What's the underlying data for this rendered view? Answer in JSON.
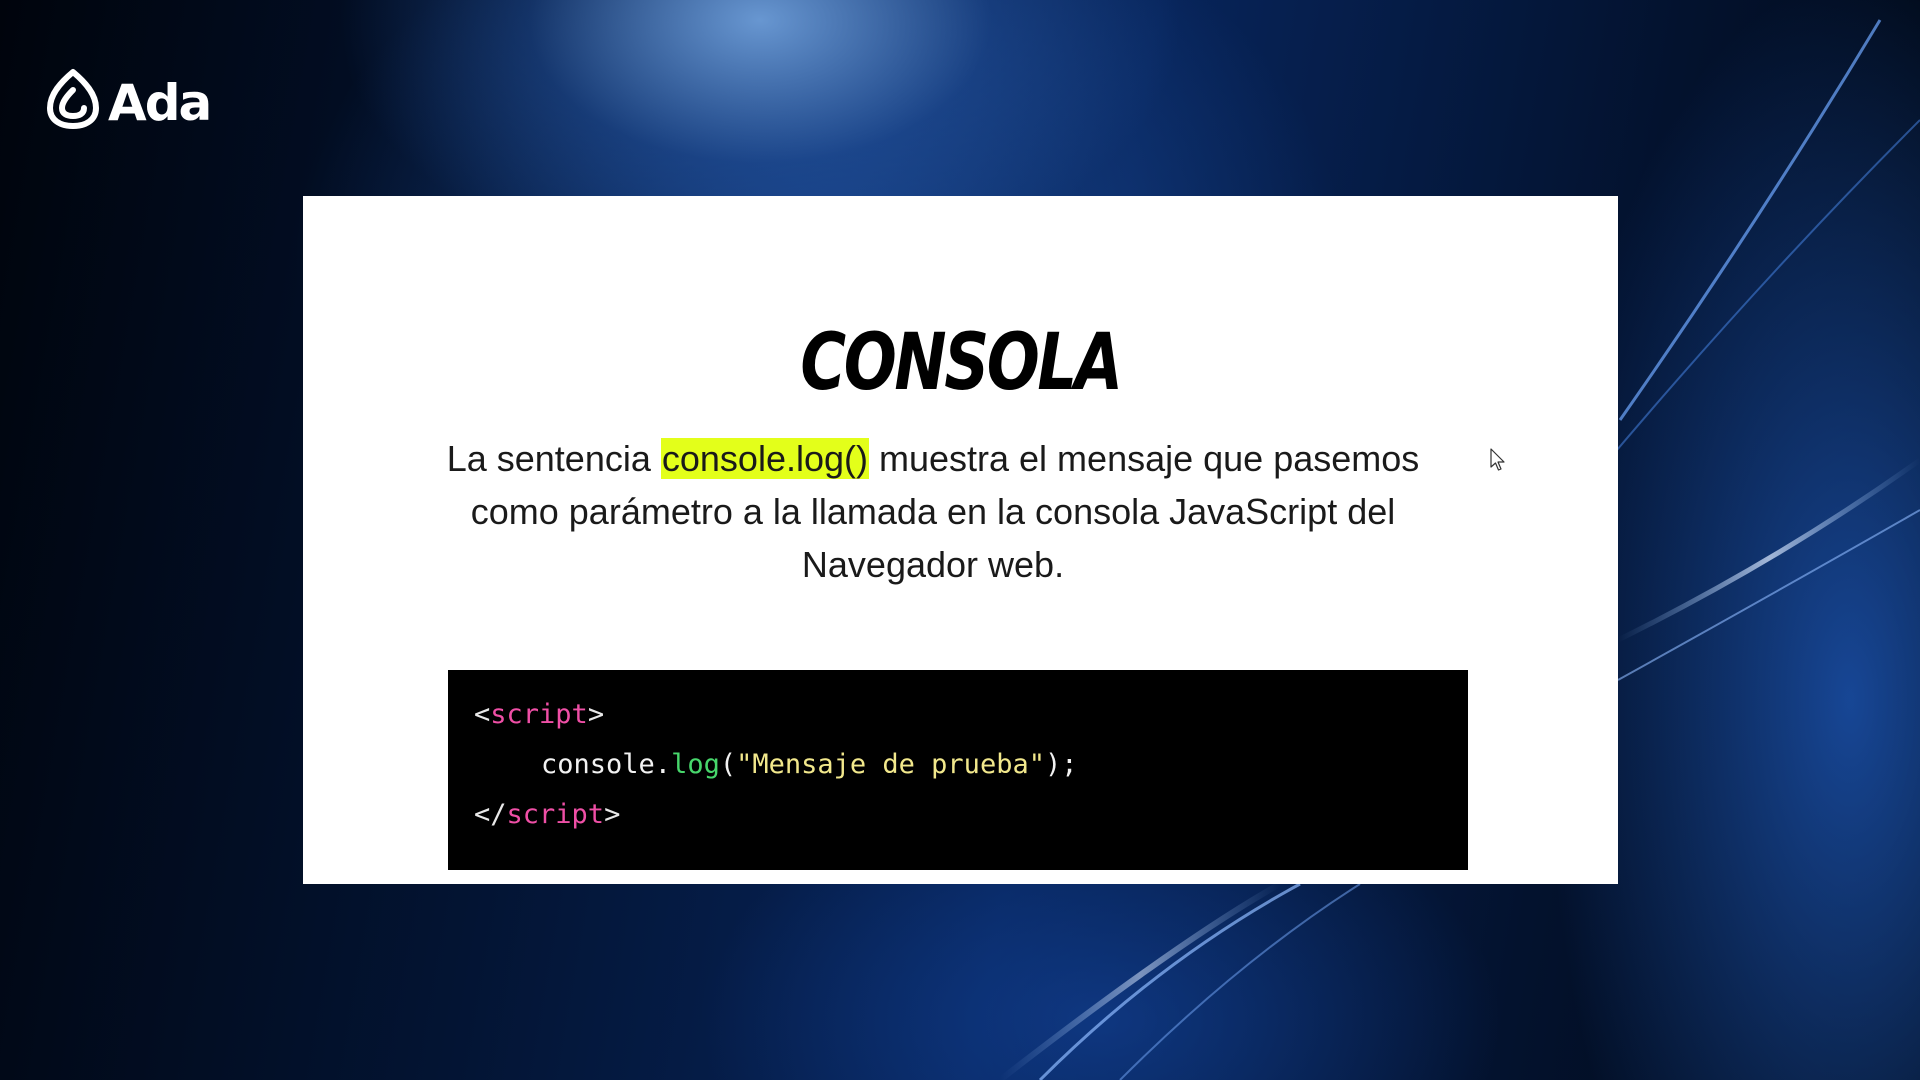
{
  "brand": {
    "name": "Ada",
    "logo_icon": "ada-logo-icon"
  },
  "slide": {
    "title": "CONSOLA",
    "description": {
      "before": "La sentencia ",
      "highlight": "console.log()",
      "after": " muestra el mensaje que pasemos como parámetro a la llamada en la consola JavaScript del Navegador web."
    },
    "highlight_color": "#e3ff1a"
  },
  "code": {
    "open_lt": "<",
    "open_tag": "script",
    "open_gt": ">",
    "object": "console",
    "dot": ".",
    "method": "log",
    "paren_open": "(",
    "string": "\"Mensaje de prueba\"",
    "paren_close": ");",
    "close_lt": "</",
    "close_tag": "script",
    "close_gt": ">",
    "colors": {
      "tag": "#ef4fa6",
      "method": "#47d66b",
      "string": "#f2e88c",
      "background": "#000000"
    }
  },
  "pointer": "mouse-cursor-icon"
}
